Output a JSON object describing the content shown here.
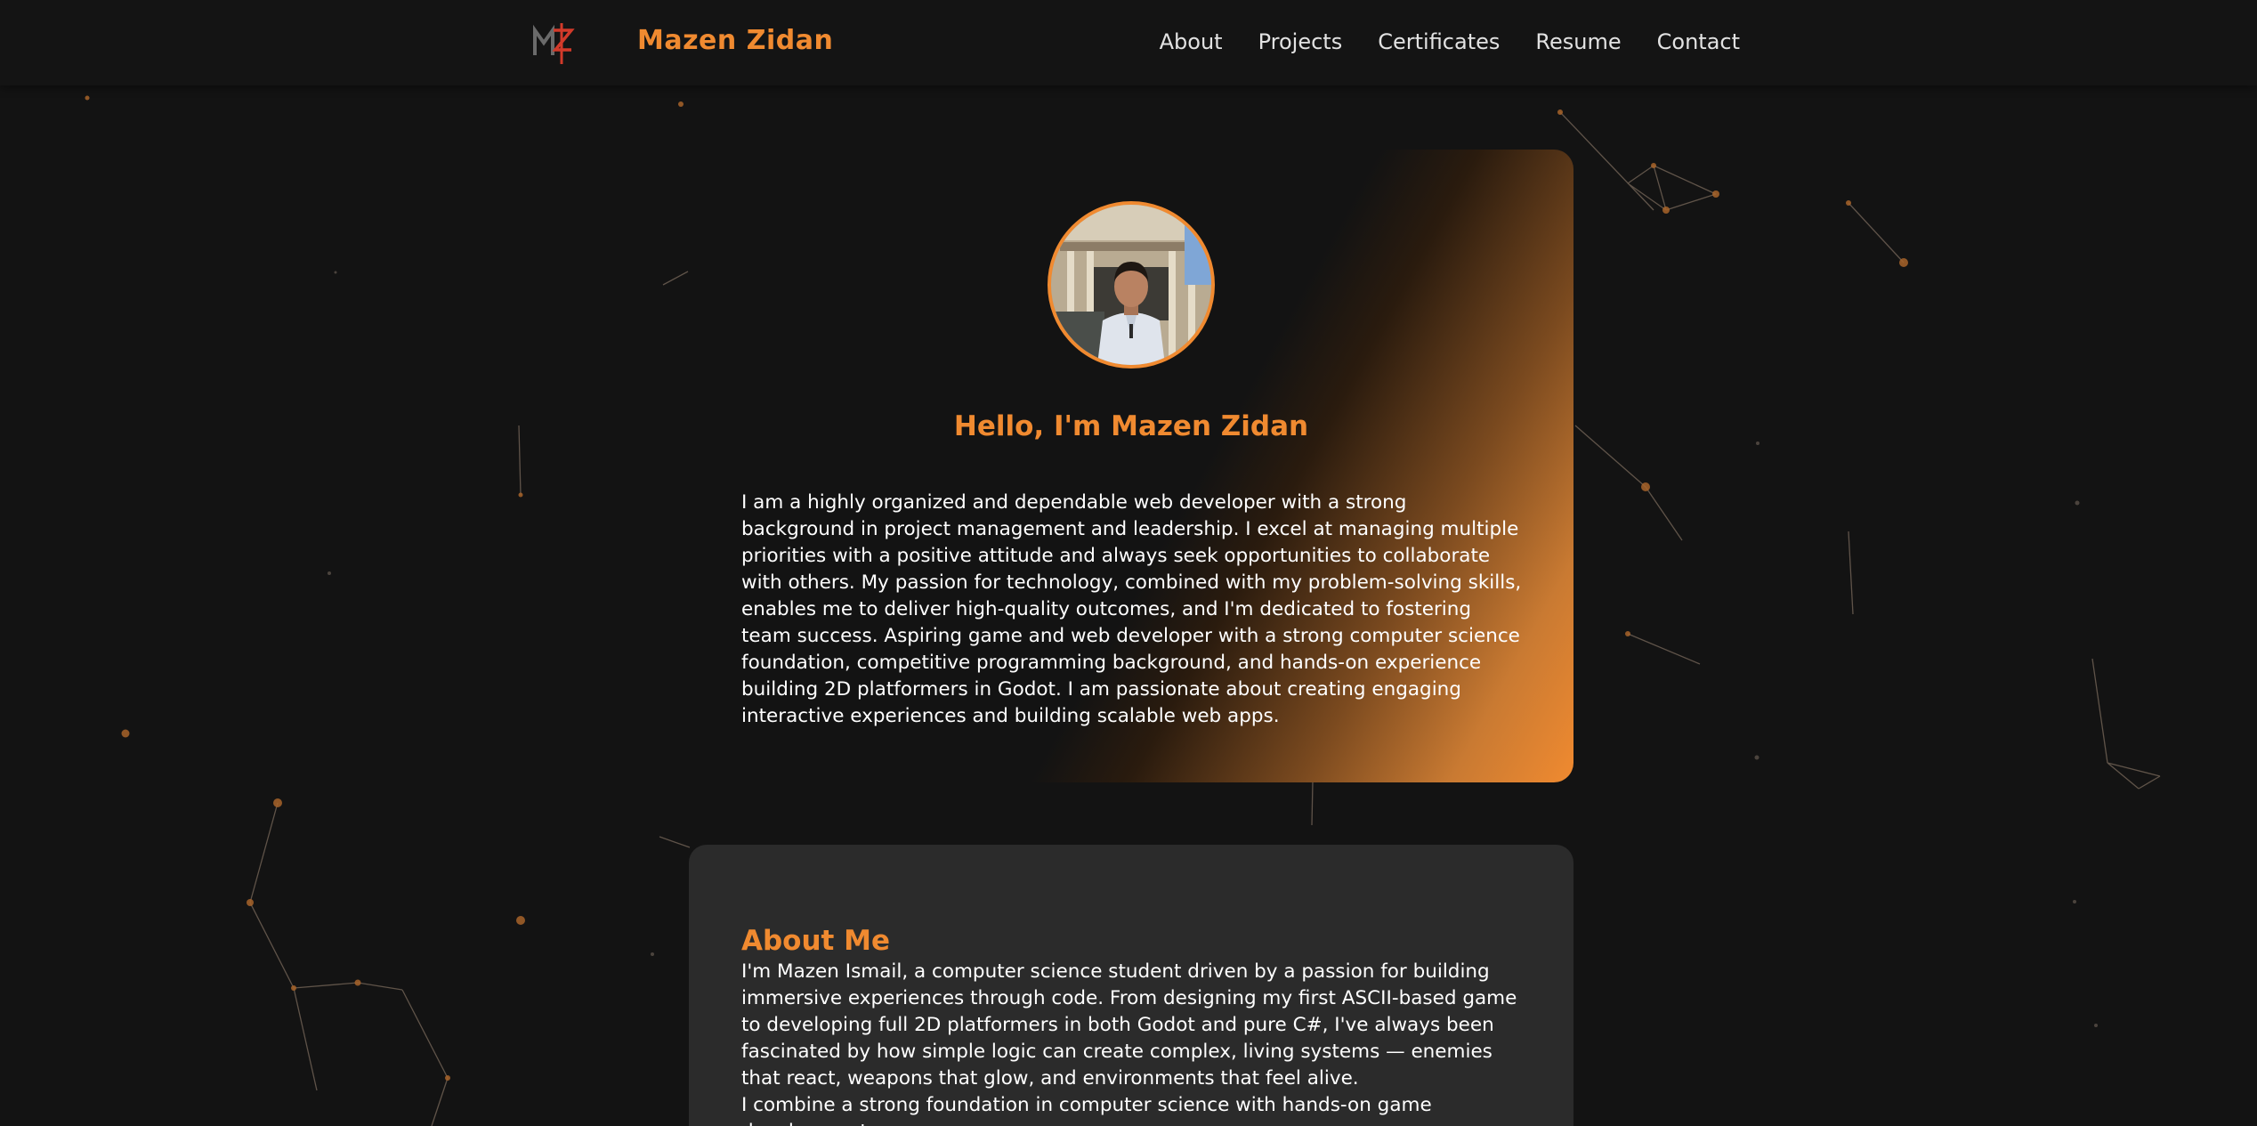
{
  "header": {
    "logo_icon": "mz-monogram-logo",
    "brand": "Mazen Zidan",
    "nav": [
      {
        "label": "About"
      },
      {
        "label": "Projects"
      },
      {
        "label": "Certificates"
      },
      {
        "label": "Resume"
      },
      {
        "label": "Contact"
      }
    ]
  },
  "hero": {
    "avatar_icon": "profile-photo",
    "title": "Hello, I'm Mazen Zidan",
    "bio": "I am a highly organized and dependable web developer with a strong background in project management and leadership. I excel at managing multiple priorities with a positive attitude and always seek opportunities to collaborate with others. My passion for technology, combined with my problem-solving skills, enables me to deliver high-quality outcomes, and I'm dedicated to fostering team success. Aspiring game and web developer with a strong computer science foundation, competitive programming background, and hands-on experience building 2D platformers in Godot. I am passionate about creating engaging interactive experiences and building scalable web apps."
  },
  "about": {
    "title": "About Me",
    "paragraphs": [
      "I'm Mazen Ismail, a computer science student driven by a passion for building immersive experiences through code. From designing my first ASCII-based game to developing full 2D platformers in both Godot and pure C#, I've always been fascinated by how simple logic can create complex, living systems — enemies that react, weapons that glow, and environments that feel alive.",
      "I combine a strong foundation in computer science with hands-on game development,"
    ]
  },
  "colors": {
    "accent": "#f08a30",
    "background": "#131313",
    "card": "#2b2b2b",
    "text": "#ffffff",
    "nav_text": "#e2e2e2"
  }
}
